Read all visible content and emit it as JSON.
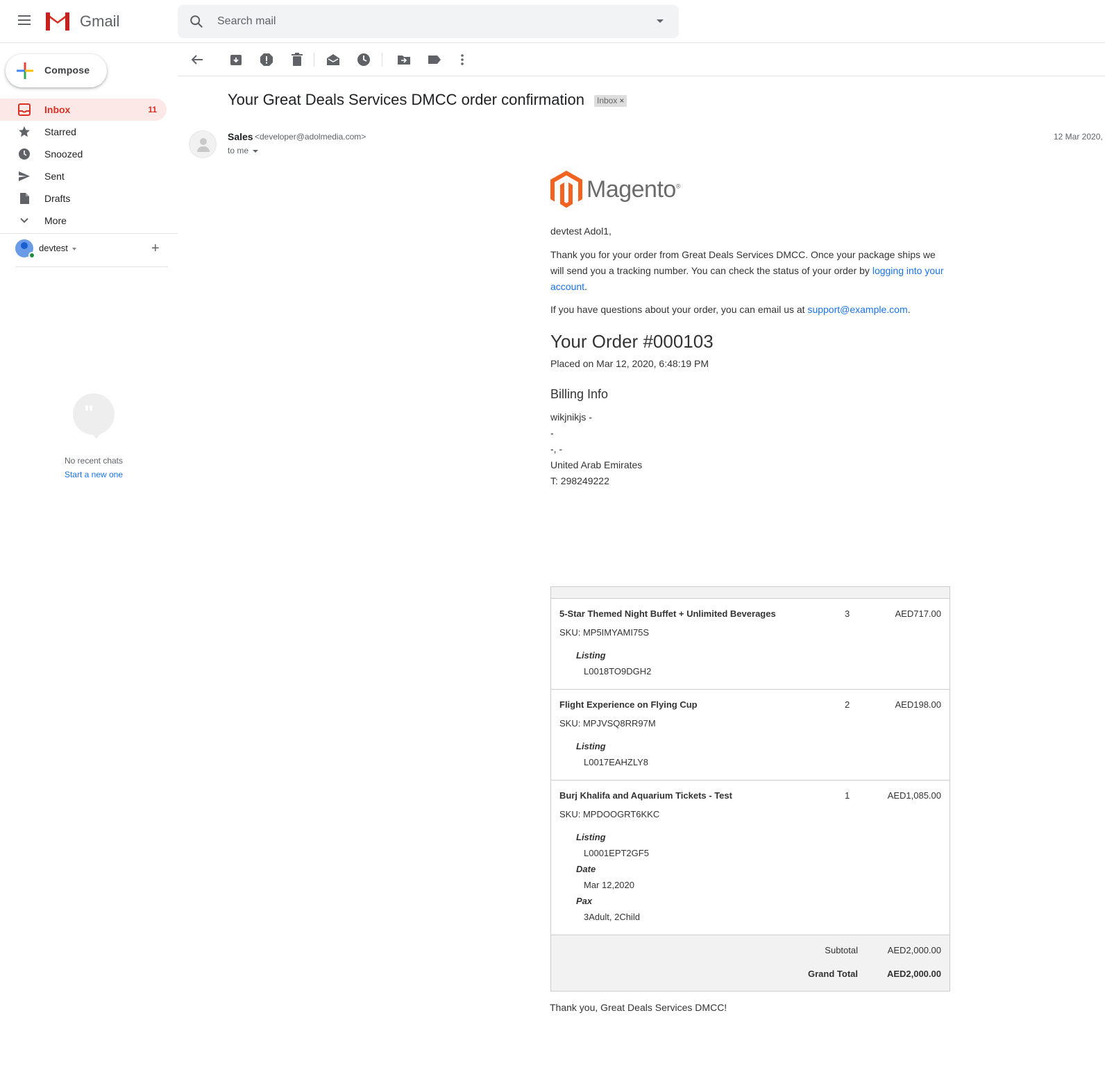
{
  "app": {
    "name": "Gmail",
    "search_placeholder": "Search mail"
  },
  "compose_label": "Compose",
  "nav": [
    {
      "label": "Inbox",
      "count": "11",
      "icon": "inbox-icon"
    },
    {
      "label": "Starred",
      "icon": "star-icon"
    },
    {
      "label": "Snoozed",
      "icon": "clock-icon"
    },
    {
      "label": "Sent",
      "icon": "send-icon"
    },
    {
      "label": "Drafts",
      "icon": "draft-icon"
    },
    {
      "label": "More",
      "icon": "chevron-down-icon"
    }
  ],
  "user": {
    "name": "devtest"
  },
  "chat": {
    "empty_text": "No recent chats",
    "start_link": "Start a new one"
  },
  "message": {
    "subject": "Your Great Deals Services DMCC order confirmation",
    "label_chip": "Inbox",
    "sender_name": "Sales",
    "sender_email": "<developer@adolmedia.com>",
    "to": "to me",
    "date": "12 Mar 2020,"
  },
  "email": {
    "brand": "Magento",
    "greeting": "devtest Adol1,",
    "thanks_p1": "Thank you for your order from Great Deals Services DMCC. Once your package ships we will send you a tracking number. You can check the status of your order by ",
    "thanks_link": "logging into your account",
    "thanks_end": ".",
    "questions_p": "If you have questions about your order, you can email us at ",
    "support_email": "support@example.com",
    "questions_end": ".",
    "order_title": "Your Order #000103",
    "placed": "Placed on Mar 12, 2020, 6:48:19 PM",
    "billing_title": "Billing Info",
    "billing_lines": [
      "wikjnikjs -",
      "-",
      "-, -",
      "United Arab Emirates",
      "T: 298249222"
    ],
    "items": [
      {
        "name": "5-Star Themed Night Buffet + Unlimited Beverages",
        "qty": "3",
        "price": "AED717.00",
        "sku": "SKU: MP5IMYAMI75S",
        "options": [
          {
            "label": "Listing",
            "value": "L0018TO9DGH2"
          }
        ]
      },
      {
        "name": "Flight Experience on Flying Cup",
        "qty": "2",
        "price": "AED198.00",
        "sku": "SKU: MPJVSQ8RR97M",
        "options": [
          {
            "label": "Listing",
            "value": "L0017EAHZLY8"
          }
        ]
      },
      {
        "name": "Burj Khalifa and Aquarium Tickets - Test",
        "qty": "1",
        "price": "AED1,085.00",
        "sku": "SKU: MPDOOGRT6KKC",
        "options": [
          {
            "label": "Listing",
            "value": "L0001EPT2GF5"
          },
          {
            "label": "Date",
            "value": "Mar 12,2020"
          },
          {
            "label": "Pax",
            "value": "3Adult, 2Child"
          }
        ]
      }
    ],
    "subtotal_label": "Subtotal",
    "subtotal_value": "AED2,000.00",
    "grand_total_label": "Grand Total",
    "grand_total_value": "AED2,000.00",
    "signoff": "Thank you, Great Deals Services DMCC!"
  },
  "colors": {
    "accent_red": "#d93025",
    "link_blue": "#1a73e8",
    "magento_orange": "#f26322"
  }
}
